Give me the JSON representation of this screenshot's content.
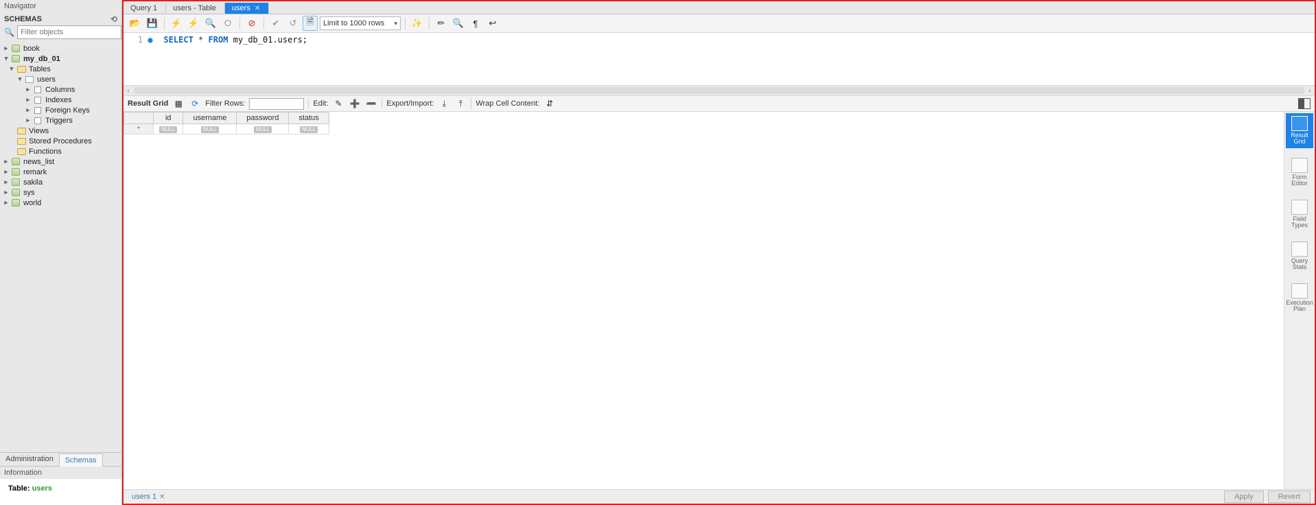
{
  "sidebar": {
    "navigator_title": "Navigator",
    "section_title": "SCHEMAS",
    "search_placeholder": "Filter objects",
    "tabs": {
      "admin": "Administration",
      "schemas": "Schemas"
    },
    "info_title": "Information",
    "info_label": "Table:",
    "info_value": "users",
    "tree": [
      {
        "label": "book",
        "type": "db",
        "expand": "▶"
      },
      {
        "label": "my_db_01",
        "type": "db",
        "expand": "▼",
        "bold": true,
        "children": [
          {
            "label": "Tables",
            "type": "folder",
            "expand": "▼",
            "children": [
              {
                "label": "users",
                "type": "table",
                "expand": "▼",
                "children": [
                  {
                    "label": "Columns",
                    "type": "col",
                    "expand": "▶"
                  },
                  {
                    "label": "Indexes",
                    "type": "col",
                    "expand": "▶"
                  },
                  {
                    "label": "Foreign Keys",
                    "type": "col",
                    "expand": "▶"
                  },
                  {
                    "label": "Triggers",
                    "type": "col",
                    "expand": "▶"
                  }
                ]
              }
            ]
          },
          {
            "label": "Views",
            "type": "folder",
            "expand": ""
          },
          {
            "label": "Stored Procedures",
            "type": "folder",
            "expand": ""
          },
          {
            "label": "Functions",
            "type": "folder",
            "expand": ""
          }
        ]
      },
      {
        "label": "news_list",
        "type": "db",
        "expand": "▶"
      },
      {
        "label": "remark",
        "type": "db",
        "expand": "▶"
      },
      {
        "label": "sakila",
        "type": "db",
        "expand": "▶"
      },
      {
        "label": "sys",
        "type": "db",
        "expand": "▶"
      },
      {
        "label": "world",
        "type": "db",
        "expand": "▶"
      }
    ]
  },
  "editor_tabs": [
    {
      "label": "Query 1",
      "active": false,
      "closable": false
    },
    {
      "label": "users - Table",
      "active": false,
      "closable": false
    },
    {
      "label": "users",
      "active": true,
      "closable": true
    }
  ],
  "toolbar": {
    "limit_label": "Limit to 1000 rows"
  },
  "sql": {
    "line_no": "1",
    "kw1": "SELECT",
    "star": "*",
    "kw2": "FROM",
    "target": "my_db_01.users;"
  },
  "result_toolbar": {
    "title": "Result Grid",
    "filter_label": "Filter Rows:",
    "edit_label": "Edit:",
    "export_label": "Export/Import:",
    "wrap_label": "Wrap Cell Content:"
  },
  "grid": {
    "columns": [
      "id",
      "username",
      "password",
      "status"
    ],
    "rows": [
      {
        "marker": "*",
        "cells": [
          "NULL",
          "NULL",
          "NULL",
          "NULL"
        ]
      }
    ]
  },
  "side_tabs": [
    {
      "label": "Result\nGrid",
      "active": true
    },
    {
      "label": "Form\nEditor",
      "active": false
    },
    {
      "label": "Field\nTypes",
      "active": false
    },
    {
      "label": "Query\nStats",
      "active": false
    },
    {
      "label": "Execution\nPlan",
      "active": false
    }
  ],
  "bottom": {
    "tab_label": "users 1",
    "apply": "Apply",
    "revert": "Revert"
  }
}
